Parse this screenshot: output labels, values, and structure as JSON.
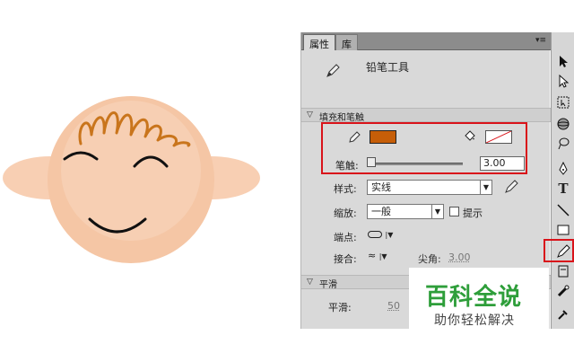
{
  "tabs": {
    "properties": "属性",
    "library": "库"
  },
  "tool": {
    "name": "铅笔工具"
  },
  "sections": {
    "fill_stroke": "填充和笔触",
    "smooth": "平滑"
  },
  "fill_stroke": {
    "stroke_color": "#c65e08",
    "fill_color": "none",
    "stroke_label": "笔触:",
    "stroke_value": "3.00",
    "stroke_slider_fraction": 0.03,
    "style_label": "样式:",
    "style_value": "实线",
    "scale_label": "缩放:",
    "scale_value": "一般",
    "hint_label": "提示",
    "cap_label": "端点:",
    "join_label": "接合:",
    "miter_label": "尖角:",
    "miter_value": "3.00"
  },
  "smooth": {
    "label": "平滑:",
    "value": "50"
  },
  "watermark": {
    "title": "百科全说",
    "subtitle": "助你轻松解决"
  },
  "colors": {
    "face": "#f8cfb3",
    "hair": "#c9751c",
    "highlight": "#d9131a"
  }
}
